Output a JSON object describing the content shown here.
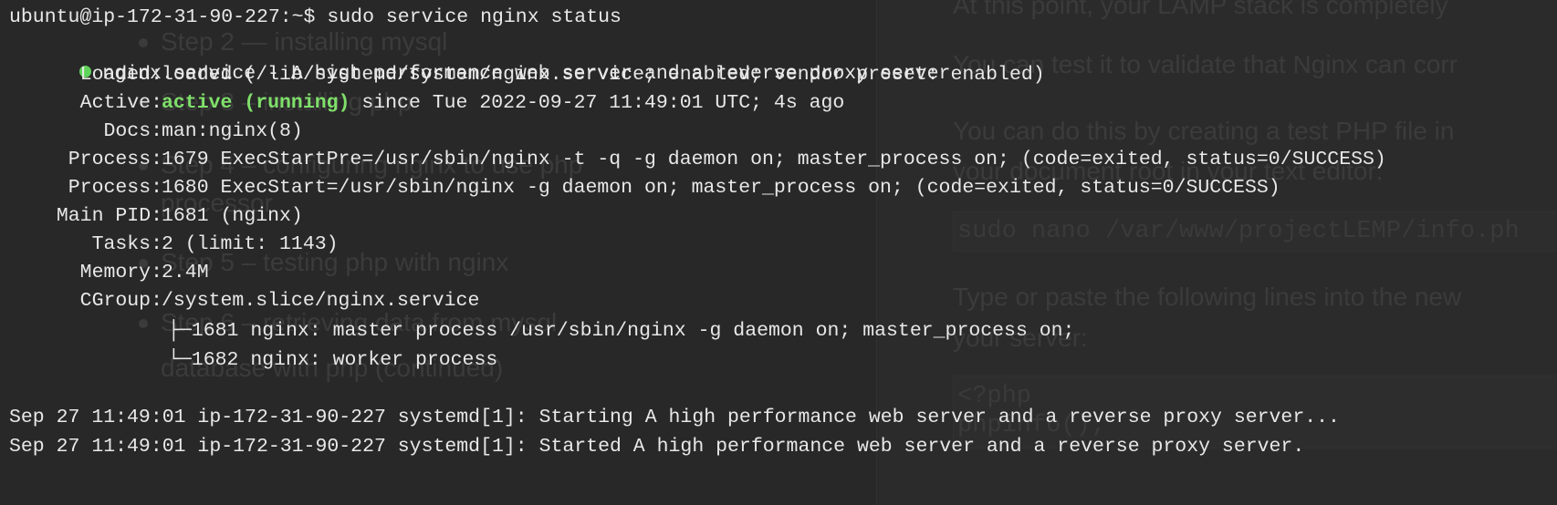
{
  "background_doc": {
    "toc": [
      {
        "label": "Step 2 — installing mysql"
      },
      {
        "label": "Step 3 – installing php"
      },
      {
        "label": "Step 4 – configuring nginx to use php",
        "continued": "processor"
      },
      {
        "label": "Step 5 – testing php with nginx"
      },
      {
        "label": "Step 6 – retrieving data from mysql",
        "continued": "database with php (continued)"
      }
    ],
    "paragraphs": [
      "At this point, your LAMP stack is completely",
      "You can test it to validate that Nginx can corr",
      "You can do this by creating a test PHP file in",
      "your document root in your text editor:",
      "Type or paste the following lines into the new",
      "your server:"
    ],
    "code_block_1": "sudo nano /var/www/projectLEMP/info.ph",
    "code_block_2_lines": [
      "<?php",
      "phpinfo();"
    ]
  },
  "terminal": {
    "prompt": "ubuntu@ip-172-31-90-227:~$ sudo service nginx status",
    "service_line": "nginx.service - A high performance web server and a reverse proxy server",
    "status_dot_color": "#5fd35a",
    "fields": [
      {
        "key": "Loaded:",
        "value": "loaded (/lib/systemd/system/nginx.service; enabled; vendor preset: enabled)"
      },
      {
        "key": "Active:",
        "value_highlight": "active (running)",
        "value": " since Tue 2022-09-27 11:49:01 UTC; 4s ago"
      },
      {
        "key": "Docs:",
        "value": "man:nginx(8)"
      },
      {
        "key": "Process:",
        "value": "1679 ExecStartPre=/usr/sbin/nginx -t -q -g daemon on; master_process on; (code=exited, status=0/SUCCESS)"
      },
      {
        "key": "Process:",
        "value": "1680 ExecStart=/usr/sbin/nginx -g daemon on; master_process on; (code=exited, status=0/SUCCESS)"
      },
      {
        "key": "Main PID:",
        "value": "1681 (nginx)"
      },
      {
        "key": "Tasks:",
        "value": "2 (limit: 1143)"
      },
      {
        "key": "Memory:",
        "value": "2.4M"
      },
      {
        "key": "CGroup:",
        "value": "/system.slice/nginx.service"
      }
    ],
    "cgroup_tree": [
      "├─1681 nginx: master process /usr/sbin/nginx -g daemon on; master_process on;",
      "└─1682 nginx: worker process"
    ],
    "log_lines": [
      "Sep 27 11:49:01 ip-172-31-90-227 systemd[1]: Starting A high performance web server and a reverse proxy server...",
      "Sep 27 11:49:01 ip-172-31-90-227 systemd[1]: Started A high performance web server and a reverse proxy server."
    ]
  }
}
